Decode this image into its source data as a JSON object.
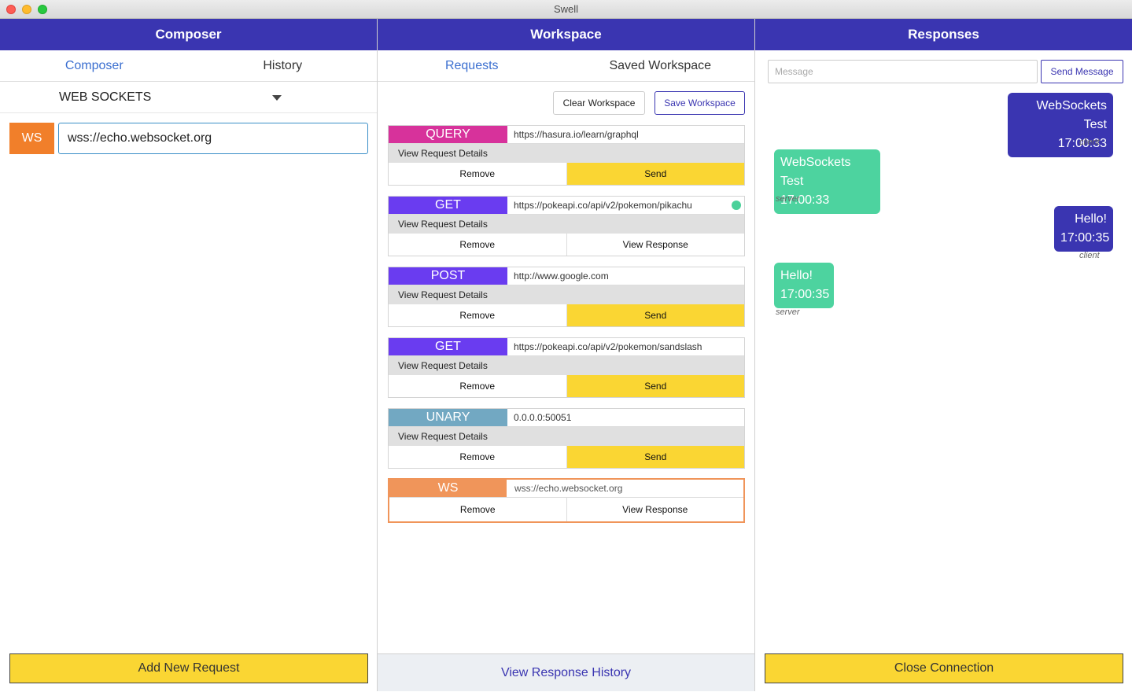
{
  "window": {
    "title": "Swell"
  },
  "composer": {
    "header": "Composer",
    "tabs": [
      "Composer",
      "History"
    ],
    "protocol": "WEB SOCKETS",
    "badge": "WS",
    "url": "wss://echo.websocket.org",
    "add_button": "Add New Request"
  },
  "workspace": {
    "header": "Workspace",
    "tabs": [
      "Requests",
      "Saved Workspace"
    ],
    "clear_button": "Clear Workspace",
    "save_button": "Save Workspace",
    "details_label": "View Request Details",
    "remove_label": "Remove",
    "send_label": "Send",
    "view_response_label": "View Response",
    "history_button": "View Response History",
    "requests": [
      {
        "method": "QUERY",
        "url": "https://hasura.io/learn/graphql",
        "color": "#d7329b"
      },
      {
        "method": "GET",
        "url": "https://pokeapi.co/api/v2/pokemon/pikachu",
        "color": "#6a3cf0"
      },
      {
        "method": "POST",
        "url": "http://www.google.com",
        "color": "#6a3cf0"
      },
      {
        "method": "GET",
        "url": "https://pokeapi.co/api/v2/pokemon/sandslash",
        "color": "#6a3cf0"
      },
      {
        "method": "UNARY",
        "url": "0.0.0.0:50051",
        "color": "#72a8c2"
      },
      {
        "method": "WS",
        "url": "wss://echo.websocket.org",
        "color": "#f0955a"
      }
    ]
  },
  "responses": {
    "header": "Responses",
    "message_placeholder": "Message",
    "send_button": "Send Message",
    "close_button": "Close Connection",
    "messages": [
      {
        "text": "WebSockets Test",
        "time": "17:00:33",
        "sender": "client"
      },
      {
        "text": "WebSockets Test",
        "time": "17:00:33",
        "sender": "server"
      },
      {
        "text": "Hello!",
        "time": "17:00:35",
        "sender": "client"
      },
      {
        "text": "Hello!",
        "time": "17:00:35",
        "sender": "server"
      }
    ]
  }
}
